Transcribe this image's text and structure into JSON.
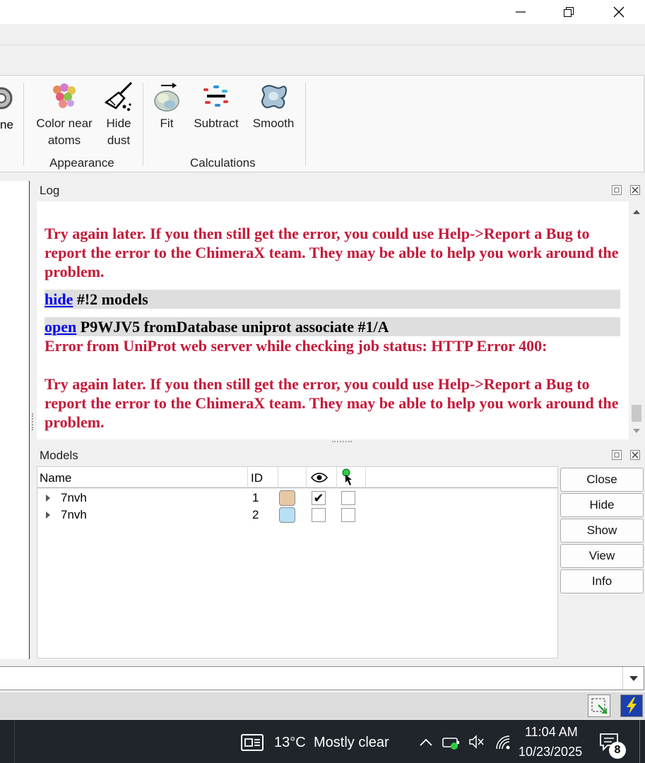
{
  "window": {
    "minimize_icon": "minimize-icon",
    "restore_icon": "restore-icon",
    "close_icon": "close-icon"
  },
  "ribbon": {
    "partial_label": "ne",
    "buttons": [
      {
        "label_line1": "Color near",
        "label_line2": "atoms",
        "icon": "color-near-atoms-icon"
      },
      {
        "label_line1": "Hide",
        "label_line2": "dust",
        "icon": "broom-icon"
      },
      {
        "label_line1": "Fit",
        "label_line2": "",
        "icon": "fit-icon"
      },
      {
        "label_line1": "Subtract",
        "label_line2": "",
        "icon": "subtract-icon"
      },
      {
        "label_line1": "Smooth",
        "label_line2": "",
        "icon": "smooth-icon"
      }
    ],
    "groups": {
      "appearance": "Appearance",
      "calculations": "Calculations"
    }
  },
  "log": {
    "title": "Log",
    "entries": {
      "err1": "Try again later. If you then still get the error, you could use Help->Report a Bug to report the error to the ChimeraX team. They may be able to help you work around the problem.",
      "cmd1_link": "hide",
      "cmd1_rest": " #!2 models",
      "cmd2_link": "open",
      "cmd2_rest": " P9WJV5 fromDatabase uniprot associate #1/A",
      "err2": "Error from UniProt web server while checking job status: HTTP Error 400:",
      "err3": "Try again later. If you then still get the error, you could use Help->Report a Bug to report the error to the ChimeraX team. They may be able to help you work around the problem."
    }
  },
  "models": {
    "title": "Models",
    "columns": {
      "name": "Name",
      "id": "ID"
    },
    "rows": [
      {
        "name": "7nvh",
        "id": "1",
        "color": "#e6c9a4",
        "shown": true
      },
      {
        "name": "7nvh",
        "id": "2",
        "color": "#b8e0f4",
        "shown": false
      }
    ],
    "buttons": {
      "close": "Close",
      "hide": "Hide",
      "show": "Show",
      "view": "View",
      "info": "Info"
    }
  },
  "taskbar": {
    "weather_temp": "13°C",
    "weather_desc": "Mostly clear",
    "time": "11:04 AM",
    "date": "10/23/2025",
    "notification_count": "8"
  }
}
